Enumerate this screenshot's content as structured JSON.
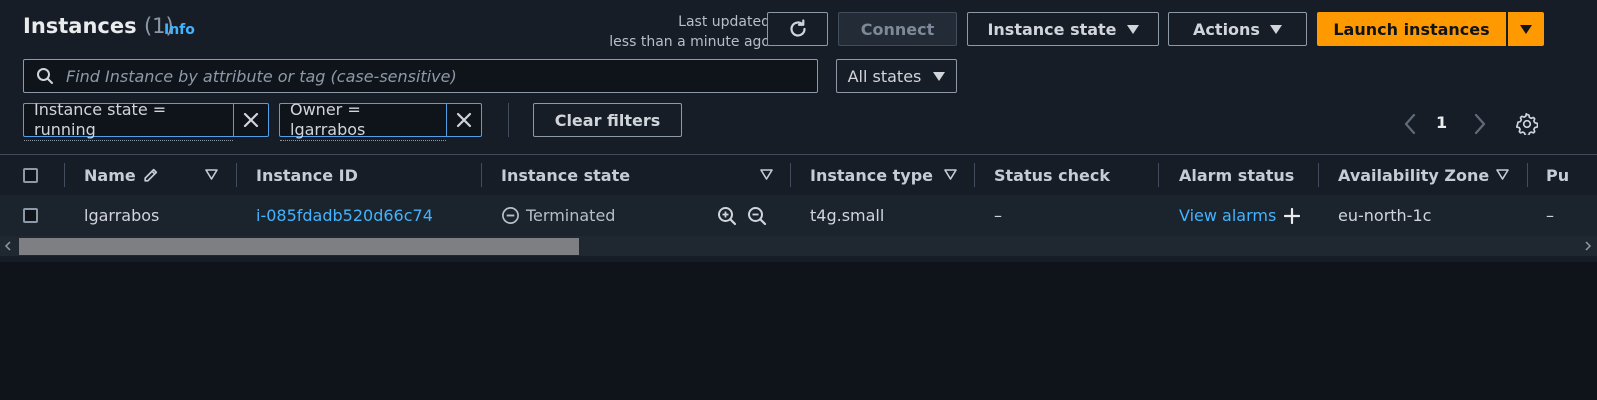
{
  "header": {
    "title": "Instances",
    "count": "(1)",
    "info_link": "Info",
    "last_updated_line1": "Last updated",
    "last_updated_line2": "less than a minute ago"
  },
  "actions": {
    "refresh_icon": "refresh-icon",
    "connect": "Connect",
    "instance_state": "Instance state",
    "actions": "Actions",
    "launch": "Launch instances"
  },
  "search": {
    "placeholder": "Find Instance by attribute or tag (case-sensitive)",
    "value": ""
  },
  "state_filter": {
    "selected": "All states"
  },
  "tokens": [
    {
      "label": "Instance state = running"
    },
    {
      "label": "Owner = lgarrabos"
    }
  ],
  "clear_filters": "Clear filters",
  "pagination": {
    "page": "1"
  },
  "table": {
    "columns": [
      "Name",
      "Instance ID",
      "Instance state",
      "Instance type",
      "Status check",
      "Alarm status",
      "Availability Zone",
      "Pu"
    ],
    "rows": [
      {
        "name": "lgarrabos",
        "instance_id": "i-085fdadb520d66c74",
        "state": "Terminated",
        "type": "t4g.small",
        "status_check": "–",
        "alarm": "View alarms",
        "az": "eu-north-1c",
        "public": "–"
      }
    ]
  },
  "colors": {
    "accent": "#ff9900",
    "link": "#42b4ff",
    "background": "#161d26",
    "token_border": "#539fe5"
  }
}
